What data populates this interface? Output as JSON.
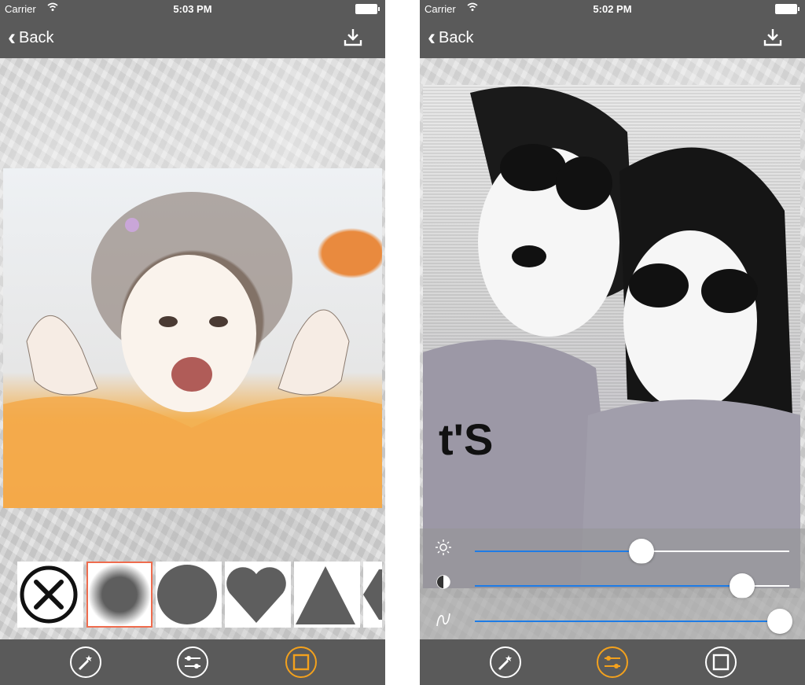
{
  "colors": {
    "bar": "#5a5a5a",
    "accent": "#f3a11d",
    "selection": "#ef6c4e",
    "slider": "#1e7ce6"
  },
  "left_screen": {
    "status": {
      "carrier": "Carrier",
      "time": "5:03 PM"
    },
    "nav": {
      "back_label": "Back",
      "download_icon": "download-icon"
    },
    "shapes": [
      {
        "name": "none-shape",
        "selected": false
      },
      {
        "name": "blur-circle-shape",
        "selected": true
      },
      {
        "name": "circle-shape",
        "selected": false
      },
      {
        "name": "heart-shape",
        "selected": false
      },
      {
        "name": "triangle-shape",
        "selected": false
      },
      {
        "name": "hexagon-shape",
        "selected": false
      }
    ],
    "toolbar": [
      {
        "icon": "magic-wand-icon",
        "active": false
      },
      {
        "icon": "adjust-sliders-icon",
        "active": false
      },
      {
        "icon": "frame-icon",
        "active": true
      }
    ]
  },
  "right_screen": {
    "status": {
      "carrier": "Carrier",
      "time": "5:02 PM"
    },
    "nav": {
      "back_label": "Back",
      "download_icon": "download-icon"
    },
    "sliders": [
      {
        "icon": "brightness-icon",
        "value": 0.53
      },
      {
        "icon": "contrast-icon",
        "value": 0.85
      },
      {
        "icon": "curve-icon",
        "value": 0.97
      }
    ],
    "toolbar": [
      {
        "icon": "magic-wand-icon",
        "active": false
      },
      {
        "icon": "adjust-sliders-icon",
        "active": true
      },
      {
        "icon": "frame-icon",
        "active": false
      }
    ]
  }
}
